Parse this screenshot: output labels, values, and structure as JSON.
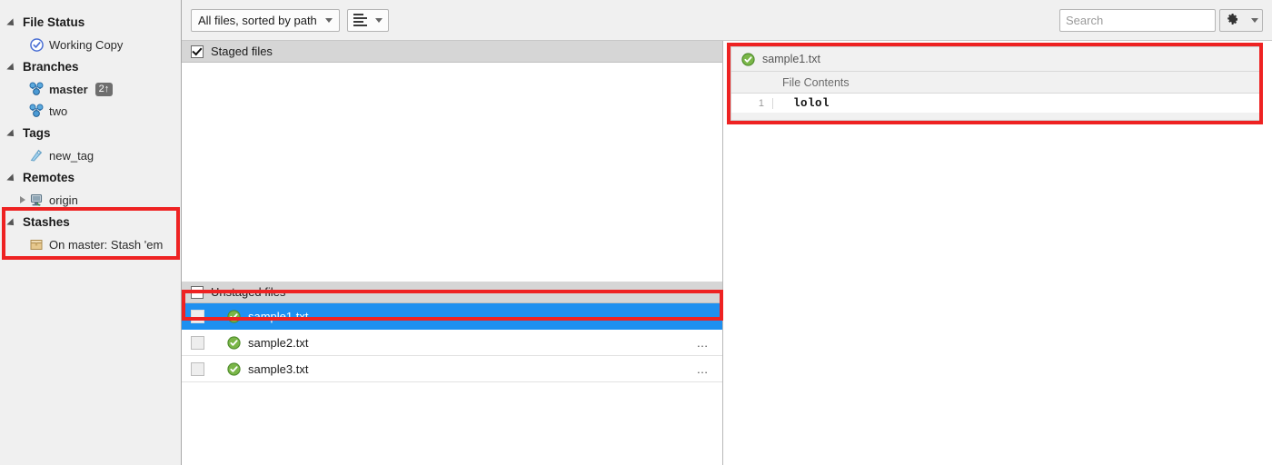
{
  "sidebar": {
    "groups": [
      {
        "name": "file-status",
        "label": "File Status",
        "items": [
          {
            "name": "working-copy",
            "label": "Working Copy",
            "icon": "blue-check-circle-icon"
          }
        ]
      },
      {
        "name": "branches",
        "label": "Branches",
        "items": [
          {
            "name": "master",
            "label": "master",
            "icon": "branch-icon",
            "badge": "2↑",
            "bold": true
          },
          {
            "name": "two",
            "label": "two",
            "icon": "branch-icon",
            "badge": "",
            "bold": false
          }
        ]
      },
      {
        "name": "tags",
        "label": "Tags",
        "items": [
          {
            "name": "new-tag",
            "label": "new_tag",
            "icon": "tag-icon"
          }
        ]
      },
      {
        "name": "remotes",
        "label": "Remotes",
        "items": [
          {
            "name": "origin",
            "label": "origin",
            "icon": "server-icon",
            "expandable": true
          }
        ]
      },
      {
        "name": "stashes",
        "label": "Stashes",
        "items": [
          {
            "name": "stash-on-master",
            "label": "On master: Stash 'em",
            "icon": "box-icon"
          }
        ]
      }
    ]
  },
  "toolbar": {
    "filter_label": "All files, sorted by path",
    "view_mode_icon": "list-view-icon",
    "search_placeholder": "Search",
    "search_value": "",
    "settings_icon": "gear-icon"
  },
  "staged": {
    "header_label": "Staged files",
    "checked": true,
    "rows": []
  },
  "unstaged": {
    "header_label": "Unstaged files",
    "checked": false,
    "rows": [
      {
        "name": "sample1.txt",
        "status_icon": "green-check-icon",
        "checked": false,
        "selected": true,
        "more": "…"
      },
      {
        "name": "sample2.txt",
        "status_icon": "green-check-icon",
        "checked": false,
        "selected": false,
        "more": "…"
      },
      {
        "name": "sample3.txt",
        "status_icon": "green-check-icon",
        "checked": false,
        "selected": false,
        "more": "…"
      }
    ]
  },
  "preview": {
    "file_name": "sample1.txt",
    "status_icon": "green-check-icon",
    "column_header": "File Contents",
    "lines": [
      {
        "number": "1",
        "text": "lolol"
      }
    ]
  },
  "colors": {
    "selection_blue": "#1e90f0",
    "annotation_red": "#ee2222",
    "sidebar_bg": "#f0f0f0",
    "section_header_bg": "#d6d6d6",
    "status_green": "#6aa84f",
    "working_copy_blue": "#4a6fd4"
  }
}
